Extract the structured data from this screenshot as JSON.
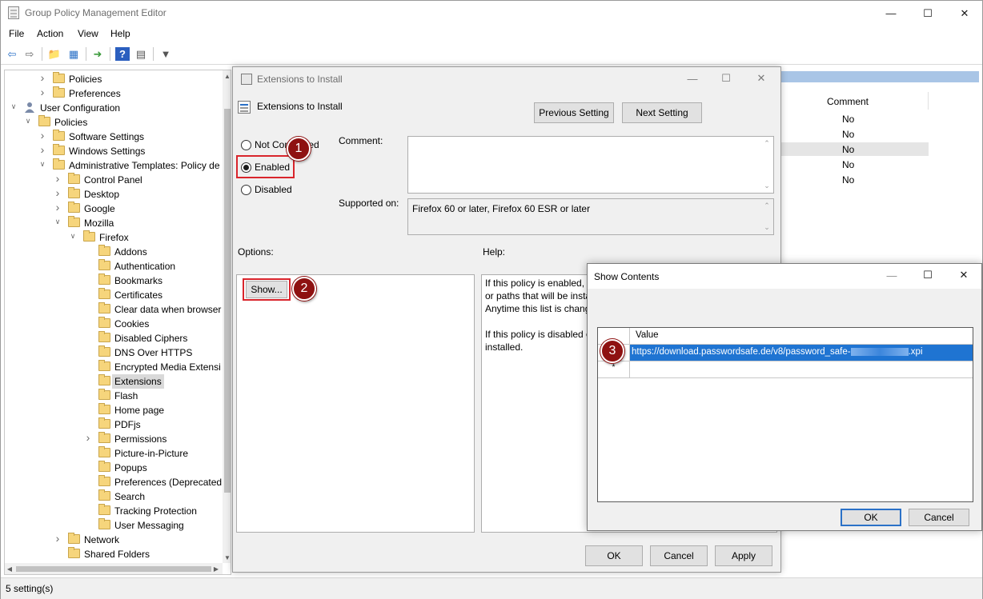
{
  "window": {
    "title": "Group Policy Management Editor"
  },
  "menu": [
    "File",
    "Action",
    "View",
    "Help"
  ],
  "tree": [
    {
      "label": "Policies",
      "level": 2,
      "arrow": "right"
    },
    {
      "label": "Preferences",
      "level": 2,
      "arrow": "right"
    },
    {
      "label": "User Configuration",
      "level": 0,
      "arrow": "down",
      "icon": "user"
    },
    {
      "label": "Policies",
      "level": 1,
      "arrow": "down"
    },
    {
      "label": "Software Settings",
      "level": 2,
      "arrow": "right"
    },
    {
      "label": "Windows Settings",
      "level": 2,
      "arrow": "right"
    },
    {
      "label": "Administrative Templates: Policy de",
      "level": 2,
      "arrow": "down"
    },
    {
      "label": "Control Panel",
      "level": 3,
      "arrow": "right"
    },
    {
      "label": "Desktop",
      "level": 3,
      "arrow": "right"
    },
    {
      "label": "Google",
      "level": 3,
      "arrow": "right"
    },
    {
      "label": "Mozilla",
      "level": 3,
      "arrow": "down"
    },
    {
      "label": "Firefox",
      "level": 4,
      "arrow": "down"
    },
    {
      "label": "Addons",
      "level": 5
    },
    {
      "label": "Authentication",
      "level": 5
    },
    {
      "label": "Bookmarks",
      "level": 5
    },
    {
      "label": "Certificates",
      "level": 5
    },
    {
      "label": "Clear data when browser",
      "level": 5
    },
    {
      "label": "Cookies",
      "level": 5
    },
    {
      "label": "Disabled Ciphers",
      "level": 5
    },
    {
      "label": "DNS Over HTTPS",
      "level": 5
    },
    {
      "label": "Encrypted Media Extensi",
      "level": 5
    },
    {
      "label": "Extensions",
      "level": 5,
      "selected": true
    },
    {
      "label": "Flash",
      "level": 5
    },
    {
      "label": "Home page",
      "level": 5
    },
    {
      "label": "PDFjs",
      "level": 5
    },
    {
      "label": "Permissions",
      "level": 5,
      "arrow": "right"
    },
    {
      "label": "Picture-in-Picture",
      "level": 5
    },
    {
      "label": "Popups",
      "level": 5
    },
    {
      "label": "Preferences (Deprecated",
      "level": 5
    },
    {
      "label": "Search",
      "level": 5
    },
    {
      "label": "Tracking Protection",
      "level": 5
    },
    {
      "label": "User Messaging",
      "level": 5
    },
    {
      "label": "Network",
      "level": 3,
      "arrow": "right"
    },
    {
      "label": "Shared Folders",
      "level": 3,
      "arrow": "none"
    }
  ],
  "right_pane": {
    "column_header": "Comment",
    "values": [
      "No",
      "No",
      "No",
      "No",
      "No"
    ]
  },
  "status": "5 setting(s)",
  "ext_dialog": {
    "title": "Extensions to Install",
    "setting_name": "Extensions to Install",
    "prev_button": "Previous Setting",
    "next_button": "Next Setting",
    "radio_not_configured": "Not Configured",
    "radio_enabled": "Enabled",
    "radio_disabled": "Disabled",
    "comment_label": "Comment:",
    "supported_label": "Supported on:",
    "supported_value": "Firefox 60 or later, Firefox 60 ESR or later",
    "options_label": "Options:",
    "help_label": "Help:",
    "show_button": "Show...",
    "help_text": [
      "If this policy is enabled, y",
      "or paths that will be insta",
      "Anytime this list is chang",
      "",
      "If this policy is disabled o",
      "installed."
    ],
    "ok": "OK",
    "cancel": "Cancel",
    "apply": "Apply"
  },
  "show_dialog": {
    "title": "Show Contents",
    "column_value": "Value",
    "row_value_prefix": "https://download.passwordsafe.de/v8/password_safe-",
    "row_value_suffix": ".xpi",
    "new_row_marker": "*",
    "ok": "OK",
    "cancel": "Cancel"
  },
  "badges": [
    "1",
    "2",
    "3"
  ],
  "colors": {
    "selection": "#1f74d2",
    "highlight_red": "#d9252c",
    "badge": "#8e1111"
  }
}
